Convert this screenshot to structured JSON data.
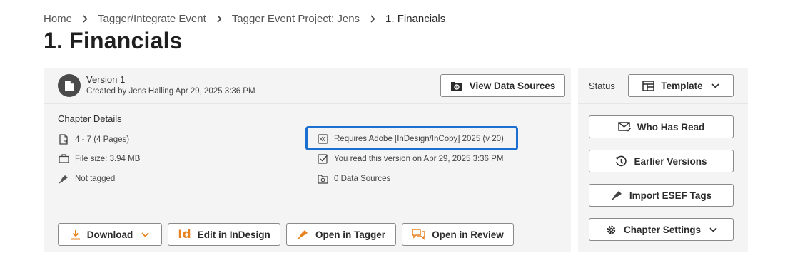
{
  "breadcrumb": {
    "items": [
      "Home",
      "Tagger/Integrate Event",
      "Tagger Event Project: Jens",
      "1. Financials"
    ]
  },
  "page": {
    "title": "1. Financials"
  },
  "version": {
    "title": "Version 1",
    "subtitle": "Created by Jens Halling Apr 29, 2025 3:36 PM",
    "view_sources_label": "View Data Sources"
  },
  "details": {
    "heading": "Chapter Details",
    "pages": "4 - 7 (4 Pages)",
    "file_size": "File size: 3.94 MB",
    "tagged": "Not tagged",
    "requires": "Requires Adobe [InDesign/InCopy] 2025 (v 20)",
    "read": "You read this version on Apr 29, 2025 3:36 PM",
    "sources": "0 Data Sources"
  },
  "actions": {
    "download": "Download",
    "edit_indesign": "Edit in InDesign",
    "open_tagger": "Open in Tagger",
    "open_review": "Open in Review"
  },
  "sidebar": {
    "status_label": "Status",
    "status_value": "Template",
    "who_has_read": "Who Has Read",
    "earlier_versions": "Earlier Versions",
    "import_esef": "Import ESEF Tags",
    "chapter_settings": "Chapter Settings"
  },
  "colors": {
    "accent_orange": "#e8821e",
    "highlight_blue": "#1a6fd1",
    "panel_bg": "#f4f4f4"
  },
  "icons": {
    "version": "document-icon",
    "pages": "file-pages-icon",
    "file_size": "file-size-icon",
    "tag": "tag-pen-icon",
    "requires": "indesign-icon",
    "read": "checkbox-icon",
    "sources": "data-source-icon",
    "download": "download-icon",
    "indesign": "indesign-id-icon",
    "tagger": "tagger-pen-icon",
    "review": "review-chat-icon",
    "template": "template-icon",
    "who_read": "envelope-check-icon",
    "earlier": "history-icon",
    "import": "tag-pen-icon",
    "settings": "gear-icon"
  }
}
